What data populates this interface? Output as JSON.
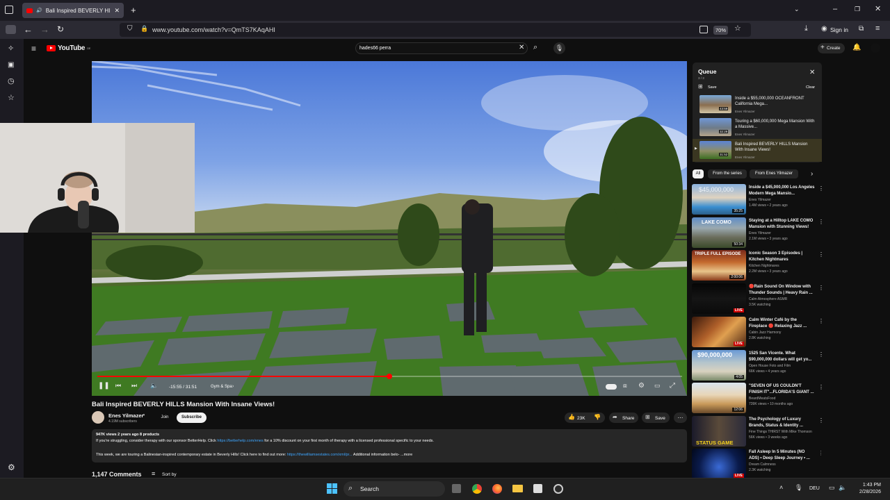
{
  "browser": {
    "tab_title": "Bali Inspired BEVERLY HILLS",
    "url": "www.youtube.com/watch?v=QmTS7KAqAHI",
    "zoom": "70%",
    "sign_in": "Sign in"
  },
  "youtube": {
    "logo_text": "YouTube",
    "logo_region": "DE",
    "search_value": "hades66 perra",
    "create_label": "Create"
  },
  "player": {
    "time": "-15:55 / 31:51",
    "chapter": "Gym & Spa",
    "progress_fraction": 0.5,
    "progress_color": "#ff0000"
  },
  "video": {
    "title": "Bali Inspired BEVERLY HILLS Mansion With Insane Views!",
    "channel": "Enes Yilmazer",
    "subscribers": "4.19M subscribers",
    "join_label": "Join",
    "subscribe_label": "Subscribe",
    "likes": "23K",
    "share_label": "Share",
    "save_label": "Save",
    "description": {
      "meta": "947K views  2 years ago  8 products",
      "line1_a": "If you're struggling, consider therapy with our sponsor BetterHelp. Click ",
      "line1_link": "https://betterhelp.com/enes",
      "line1_b": " for a 10% discount on your first month of therapy with a licensed professional specific to your needs.",
      "line2_a": "This week, we are touring a Balinesian-inspired contemporary estate in Beverly Hills! Click here to find out more: ",
      "line2_link": "https://thewilliamsestates.com/xml/pr...",
      "line2_b": "  Additional information belo-   ...more"
    },
    "comments_count": "1,147 Comments",
    "sort_label": "Sort by"
  },
  "queue": {
    "title": "Queue",
    "count": "3 / 3",
    "save_label": "Save",
    "clear_label": "Clear",
    "items": [
      {
        "title": "Inside a $55,000,000 OCEANFRONT California Mega...",
        "channel": "Enes Yilmazer",
        "duration": "43:59"
      },
      {
        "title": "Touring a $60,000,000 Mega Mansion With a Massive...",
        "channel": "Enes Yilmazer",
        "duration": "32:29"
      },
      {
        "title": "Bali Inspired BEVERLY HILLS Mansion With Insane Views!",
        "channel": "Enes Yilmazer",
        "duration": "31:52"
      }
    ]
  },
  "chips": [
    "All",
    "From the series",
    "From Enes Yilmazer"
  ],
  "recommendations": [
    {
      "title": "Inside a $45,000,000 Los Angeles Modern Mega Mansio...",
      "channel": "Enes Yilmazer",
      "meta": "1.4M views • 2 years ago",
      "badge": "35:25",
      "thumb_text": "$45,000,000"
    },
    {
      "title": "Staying at a Hilltop LAKE COMO Mansion with Stunning Views!",
      "channel": "Enes Yilmazer",
      "meta": "2.1M views • 3 years ago",
      "badge": "50:34",
      "thumb_text": "LAKE COMO"
    },
    {
      "title": "Iconic Season 3 Episodes | Kitchen Nightmares",
      "channel": "Kitchen Nightmares",
      "meta": "2.2M views • 3 years ago",
      "badge": "2:00:06",
      "thumb_text": "TRIPLE FULL EPISODE"
    },
    {
      "title": "🔴Rain Sound On Window with Thunder Sounds | Heavy Rain ...",
      "channel": "Calm Atmosphere ASMR",
      "meta": "3.5K watching",
      "badge": "LIVE",
      "thumb_text": ""
    },
    {
      "title": "Calm Winter Café by the Fireplace 🔴 Relaxing Jazz ...",
      "channel": "Cabin Jazz Harmony",
      "meta": "2.8K watching",
      "badge": "LIVE",
      "thumb_text": ""
    },
    {
      "title": "1525 San Vicente. What $90,000,000 dollars will get yo...",
      "channel": "Open House Foto and Film",
      "meta": "66K views • 4 years ago",
      "badge": "4:05",
      "thumb_text": "$90,000,000"
    },
    {
      "title": "\"SEVEN OF US COULDN'T FINISH IT\"...FLORIDA'S GIANT ...",
      "channel": "BeardMeatsFood",
      "meta": "739K views • 10 months ago",
      "badge": "12:06",
      "thumb_text": ""
    },
    {
      "title": "The Psychology of Luxury Brands, Status & Identity ...",
      "channel": "Fine Things THIRST With Mike Thomson",
      "meta": "56K views • 3 weeks ago",
      "badge": "",
      "thumb_text": "STATUS GAME"
    },
    {
      "title": "Fall Asleep In 5 Minutes (NO ADS) • Deep Sleep Journey • ...",
      "channel": "Dream Calmness",
      "meta": "2.3K watching",
      "badge": "LIVE",
      "thumb_text": ""
    }
  ],
  "taskbar": {
    "search_label": "Search",
    "lang": "DEU",
    "time": "1:43 PM",
    "date": "2/28/2026"
  }
}
